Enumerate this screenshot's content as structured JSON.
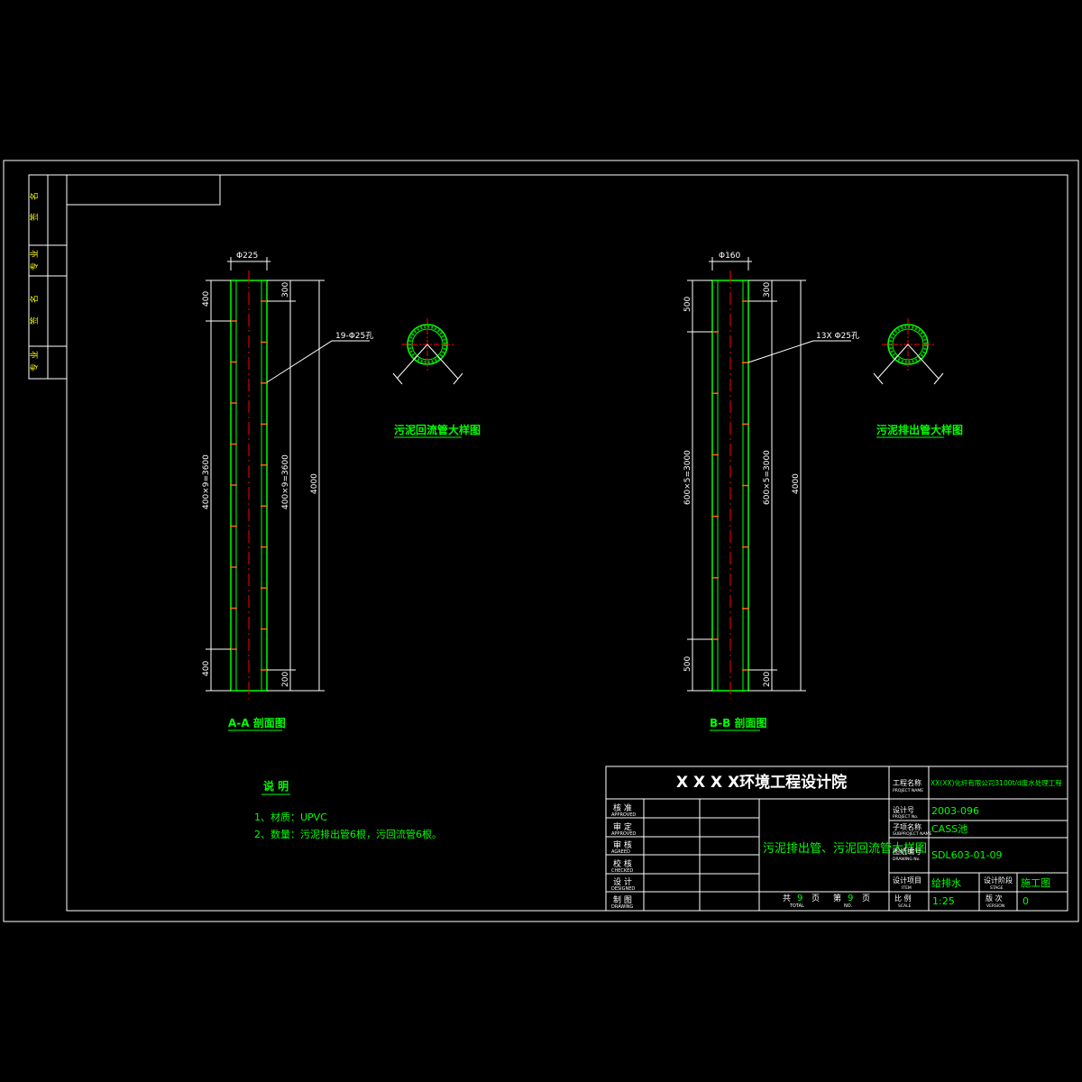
{
  "colors": {
    "background": "#000000",
    "frame": "#ffffff",
    "pipe": "#00ff00",
    "centerline": "#ff0000",
    "dimension": "#ffffff",
    "label": "#00ff00",
    "text": "#ffff00"
  },
  "side_labels": {
    "row1": [
      "签",
      "名"
    ],
    "row2": [
      "专",
      "业"
    ],
    "row3": [
      "签",
      "名"
    ],
    "row4": [
      "专",
      "业"
    ]
  },
  "section_a": {
    "diameter": "Φ225",
    "top_offset": "300",
    "top_margin": "400",
    "bottom_margin": "400",
    "bottom_offset": "200",
    "span_left": "400×9=3600",
    "span_right": "400×9=3600",
    "total": "4000",
    "hole_note": "19-Φ25孔",
    "title": "A-A 剖面图",
    "detail_title": "污泥回流管大样图"
  },
  "section_b": {
    "diameter": "Φ160",
    "top_offset": "300",
    "top_margin": "500",
    "bottom_margin": "500",
    "bottom_offset": "200",
    "span_left": "600×5=3000",
    "span_right": "600×5=3000",
    "total": "4000",
    "hole_note": "13X Φ25孔",
    "title": "B-B 剖面图",
    "detail_title": "污泥排出管大样图"
  },
  "notes": {
    "heading": "说  明",
    "line1": "1、材质：UPVC",
    "line2": "2、数量：污泥排出管6根，污回流管6根。"
  },
  "title_block": {
    "institute": "X X X X环境工程设计院",
    "drawing_title": "污泥排出管、污泥回流管大样图",
    "roles": [
      {
        "cn": "核 准",
        "en": "APPROVED"
      },
      {
        "cn": "审 定",
        "en": "APPROVED"
      },
      {
        "cn": "审 核",
        "en": "AGREED"
      },
      {
        "cn": "校 核",
        "en": "CHECKED"
      },
      {
        "cn": "设 计",
        "en": "DESIGNED"
      },
      {
        "cn": "制 图",
        "en": "DRAWING"
      }
    ],
    "project_label_cn": "工程名称",
    "project_label_en": "PROJECT NAME",
    "project_value": "XX(XX)化纤有限公司3100t/d废水处理工程",
    "project_no_label_cn": "设计号",
    "project_no_label_en": "PROJECT No.",
    "project_no": "2003-096",
    "sub_label_cn": "子项名称",
    "sub_label_en": "SUBPROJECT NAME",
    "sub_value": "CASS池",
    "drawing_no_label_cn": "图纸编号",
    "drawing_no_label_en": "DRAWING No.",
    "drawing_no": "SDL603-01-09",
    "item_label_cn": "设计项目",
    "item_label_en": "ITEM",
    "item_value": "给排水",
    "stage_label_cn": "设计阶段",
    "stage_label_en": "STAGE",
    "stage_value": "施工图",
    "scale_label_cn": "比 例",
    "scale_label_en": "SCALE",
    "scale_value": "1:25",
    "version_label_cn": "版 次",
    "version_label_en": "VERSION",
    "version_value": "0",
    "total_pages_label": "共",
    "total_pages_value": "9",
    "page_unit1": "页",
    "page_no_label": "第",
    "page_no_value": "9",
    "page_unit2": "页",
    "total_en": "TOTAL",
    "no_en": "NO."
  }
}
